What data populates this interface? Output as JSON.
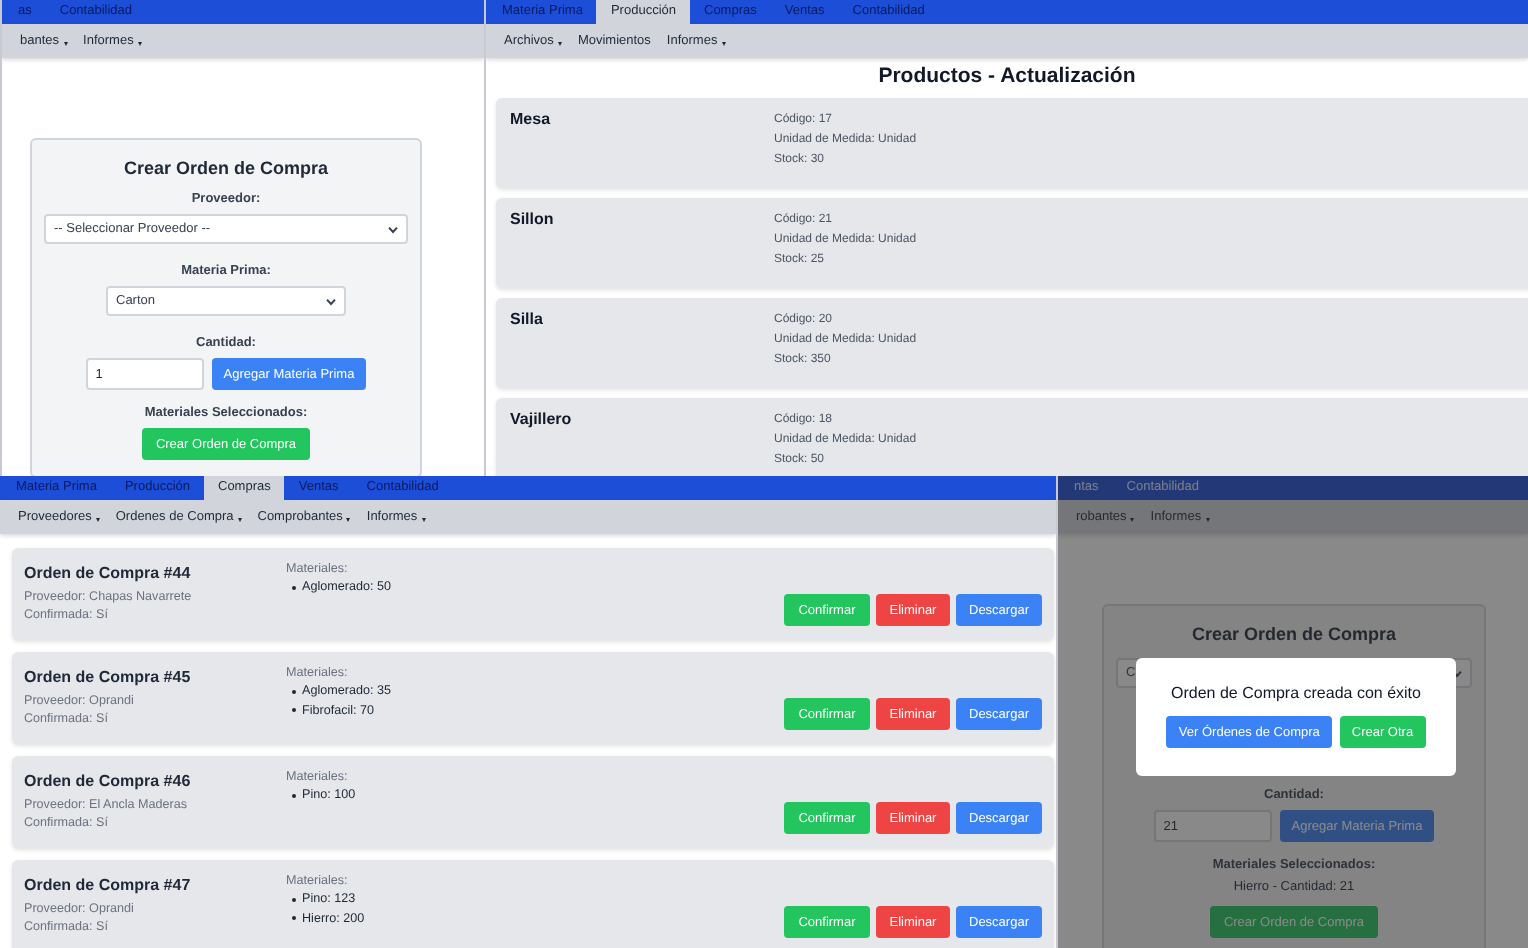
{
  "panels": [
    {
      "kind": "form",
      "tabs": [
        {
          "label": "as",
          "selected": false
        },
        {
          "label": "Contabilidad",
          "selected": false
        }
      ],
      "submenu": [
        {
          "label": "bantes",
          "dropdown": true
        },
        {
          "label": "Informes",
          "dropdown": true
        }
      ],
      "form": {
        "title": "Crear Orden de Compra",
        "rows": [
          {
            "kind": "label",
            "text": "Proveedor:"
          },
          {
            "kind": "select",
            "value": "-- Seleccionar Proveedor --"
          },
          {
            "kind": "label",
            "text": "Materia Prima:"
          },
          {
            "kind": "select",
            "value": "Carton"
          },
          {
            "kind": "label",
            "text": "Cantidad:"
          },
          {
            "kind": "input_button",
            "value": "1",
            "button": "Agregar Materia Prima"
          },
          {
            "kind": "label",
            "text": "Materiales Seleccionados:"
          },
          {
            "kind": "submit",
            "text": "Crear Orden de Compra"
          }
        ]
      }
    },
    {
      "kind": "products",
      "tabs": [
        {
          "label": "Materia Prima",
          "selected": false
        },
        {
          "label": "Producción",
          "selected": true
        },
        {
          "label": "Compras",
          "selected": false
        },
        {
          "label": "Ventas",
          "selected": false
        },
        {
          "label": "Contabilidad",
          "selected": false
        }
      ],
      "submenu": [
        {
          "label": "Archivos",
          "dropdown": true
        },
        {
          "label": "Movimientos",
          "dropdown": false
        },
        {
          "label": "Informes",
          "dropdown": true
        }
      ],
      "title": "Productos - Actualización",
      "products": [
        {
          "name": "Mesa",
          "details": [
            "Código: 17",
            "Unidad de Medida: Unidad",
            "Stock: 30"
          ]
        },
        {
          "name": "Sillon",
          "details": [
            "Código: 21",
            "Unidad de Medida: Unidad",
            "Stock: 25"
          ]
        },
        {
          "name": "Silla",
          "details": [
            "Código: 20",
            "Unidad de Medida: Unidad",
            "Stock: 350"
          ]
        },
        {
          "name": "Vajillero",
          "details": [
            "Código: 18",
            "Unidad de Medida: Unidad",
            "Stock: 50"
          ]
        }
      ]
    },
    {
      "kind": "orders",
      "tabs": [
        {
          "label": "Materia Prima",
          "selected": false
        },
        {
          "label": "Producción",
          "selected": false
        },
        {
          "label": "Compras",
          "selected": true
        },
        {
          "label": "Ventas",
          "selected": false
        },
        {
          "label": "Contabilidad",
          "selected": false
        }
      ],
      "submenu": [
        {
          "label": "Proveedores",
          "dropdown": true
        },
        {
          "label": "Ordenes de Compra",
          "dropdown": true
        },
        {
          "label": "Comprobantes",
          "dropdown": true
        },
        {
          "label": "Informes",
          "dropdown": true
        }
      ],
      "orders": [
        {
          "title": "Orden de Compra #44",
          "provider": "Proveedor: Chapas Navarrete",
          "confirmed": "Confirmada: Sí",
          "materials_label": "Materiales:",
          "materials": [
            "Aglomerado: 50"
          ],
          "actions": [
            {
              "label": "Confirmar",
              "kind": "success"
            },
            {
              "label": "Eliminar",
              "kind": "danger"
            },
            {
              "label": "Descargar",
              "kind": "primary"
            }
          ]
        },
        {
          "title": "Orden de Compra #45",
          "provider": "Proveedor: Oprandi",
          "confirmed": "Confirmada: Sí",
          "materials_label": "Materiales:",
          "materials": [
            "Aglomerado: 35",
            "Fibrofacil: 70"
          ],
          "actions": [
            {
              "label": "Confirmar",
              "kind": "success"
            },
            {
              "label": "Eliminar",
              "kind": "danger"
            },
            {
              "label": "Descargar",
              "kind": "primary"
            }
          ]
        },
        {
          "title": "Orden de Compra #46",
          "provider": "Proveedor: El Ancla Maderas",
          "confirmed": "Confirmada: Sí",
          "materials_label": "Materiales:",
          "materials": [
            "Pino: 100"
          ],
          "actions": [
            {
              "label": "Confirmar",
              "kind": "success"
            },
            {
              "label": "Eliminar",
              "kind": "danger"
            },
            {
              "label": "Descargar",
              "kind": "primary"
            }
          ]
        },
        {
          "title": "Orden de Compra #47",
          "provider": "Proveedor: Oprandi",
          "confirmed": "Confirmada: Sí",
          "materials_label": "Materiales:",
          "materials": [
            "Pino: 123",
            "Hierro: 200"
          ],
          "actions": [
            {
              "label": "Confirmar",
              "kind": "success"
            },
            {
              "label": "Eliminar",
              "kind": "danger"
            },
            {
              "label": "Descargar",
              "kind": "primary"
            }
          ]
        }
      ]
    },
    {
      "kind": "form",
      "tabs": [
        {
          "label": "ntas",
          "selected": false
        },
        {
          "label": "Contabilidad",
          "selected": false
        }
      ],
      "submenu": [
        {
          "label": "robantes",
          "dropdown": true
        },
        {
          "label": "Informes",
          "dropdown": true
        }
      ],
      "form": {
        "title": "Crear Orden de Compra",
        "rows": [
          {
            "kind": "select",
            "value": "C"
          },
          {
            "kind": "label",
            "text": "Cantidad:"
          },
          {
            "kind": "input_button",
            "value": "21",
            "button": "Agregar Materia Prima"
          },
          {
            "kind": "label",
            "text": "Materiales Seleccionados:"
          },
          {
            "kind": "text",
            "text": "Hierro - Cantidad: 21"
          },
          {
            "kind": "submit",
            "text": "Crear Orden de Compra"
          }
        ]
      },
      "modal": {
        "message": "Orden de Compra creada con éxito",
        "buttons": [
          {
            "label": "Ver Órdenes de Compra",
            "kind": "primary"
          },
          {
            "label": "Crear Otra",
            "kind": "success"
          }
        ]
      }
    }
  ]
}
